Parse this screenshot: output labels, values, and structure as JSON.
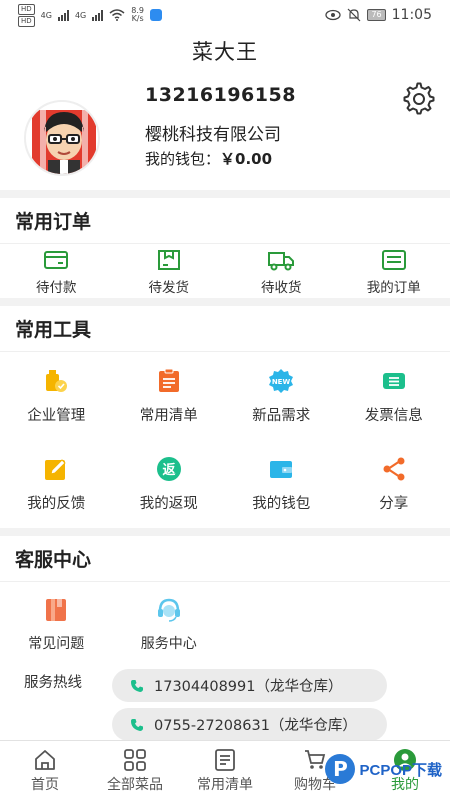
{
  "status_bar": {
    "network_1": "HD",
    "network_2": "HD",
    "signal_1": "4G",
    "signal_2": "4G",
    "speed_value": "8.9",
    "speed_unit": "K/s",
    "battery": "76",
    "time": "11:05"
  },
  "header": {
    "title": "菜大王"
  },
  "profile": {
    "phone": "13216196158",
    "company": "樱桃科技有限公司",
    "wallet_label": "我的钱包：",
    "wallet_amount": "￥0.00"
  },
  "orders": {
    "title": "常用订单",
    "items": [
      {
        "label": "待付款",
        "icon": "payment-card-icon"
      },
      {
        "label": "待发货",
        "icon": "box-icon"
      },
      {
        "label": "待收货",
        "icon": "truck-icon"
      },
      {
        "label": "我的订单",
        "icon": "receipt-icon"
      }
    ]
  },
  "tools": {
    "title": "常用工具",
    "items": [
      {
        "label": "企业管理",
        "icon": "building-icon",
        "color": "#f5b400"
      },
      {
        "label": "常用清单",
        "icon": "clipboard-icon",
        "color": "#f26b2a"
      },
      {
        "label": "新品需求",
        "icon": "new-badge-icon",
        "color": "#2bb5e8"
      },
      {
        "label": "发票信息",
        "icon": "invoice-icon",
        "color": "#1cbf8c"
      },
      {
        "label": "我的反馈",
        "icon": "feedback-edit-icon",
        "color": "#f5b400"
      },
      {
        "label": "我的返现",
        "icon": "cashback-icon",
        "color": "#1cbf8c"
      },
      {
        "label": "我的钱包",
        "icon": "wallet-icon",
        "color": "#2bb5e8"
      },
      {
        "label": "分享",
        "icon": "share-icon",
        "color": "#f26b2a"
      }
    ]
  },
  "service": {
    "title": "客服中心",
    "items": [
      {
        "label": "常见问题",
        "icon": "faq-book-icon"
      },
      {
        "label": "服务中心",
        "icon": "headset-icon"
      }
    ],
    "hotline_label": "服务热线",
    "hotlines": [
      "17304408991（龙华仓库）",
      "0755-27208631（龙华仓库）"
    ]
  },
  "tabbar": {
    "items": [
      {
        "label": "首页",
        "icon": "home-icon"
      },
      {
        "label": "全部菜品",
        "icon": "grid-icon"
      },
      {
        "label": "常用清单",
        "icon": "list-icon"
      },
      {
        "label": "购物车",
        "icon": "cart-icon"
      },
      {
        "label": "我的",
        "icon": "profile-icon"
      }
    ],
    "active_index": 4
  },
  "watermark": {
    "text": "PCPOP下载",
    "logo": "P"
  },
  "colors": {
    "accent": "#2a9a3a",
    "order_icon": "#2a9a3a"
  }
}
